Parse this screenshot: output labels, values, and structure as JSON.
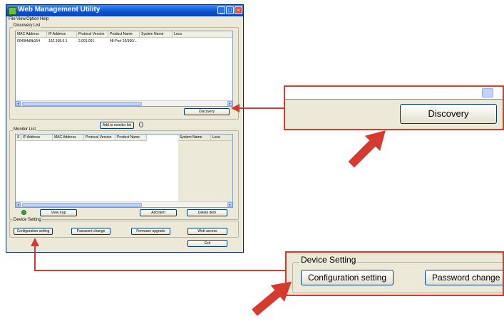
{
  "window": {
    "title": "Web Management Utility",
    "menu": [
      "File",
      "View",
      "Option",
      "Help"
    ]
  },
  "discovery": {
    "group_label": "Discovery List",
    "columns": [
      "MAC Address",
      "IP Address",
      "Protocol Version",
      "Product Name",
      "System Name",
      "Loca"
    ],
    "rows": [
      [
        "0040f4d9b154",
        "192.168.0.1",
        "2.001.001",
        "48-Port 10/100/...",
        "",
        ""
      ]
    ],
    "button": "Discovery"
  },
  "add_to_monitor_button": "Add to monitor list",
  "monitor": {
    "group_label": "Monitor List",
    "columns": [
      "S",
      "IP Address",
      "MAC Address",
      "Protocol Version",
      "Product Name",
      "System Name",
      "Loca"
    ],
    "view_trap_button": "View trap",
    "add_item_button": "Add item",
    "delete_item_button": "Delete item"
  },
  "device_setting": {
    "group_label": "Device Setting",
    "configuration_button": "Configuration setting",
    "password_button": "Password change",
    "firmware_button": "Firmware upgrade",
    "web_access_button": "Web access",
    "exit_button": "Exit"
  },
  "callout_discovery": {
    "button": "Discovery"
  },
  "callout_device": {
    "group_label": "Device Setting",
    "configuration_button": "Configuration setting",
    "password_button": "Password change"
  },
  "colors": {
    "arrow": "#d63a2f",
    "titlebar": "#0a50d0",
    "window_bg": "#ece9d8"
  }
}
